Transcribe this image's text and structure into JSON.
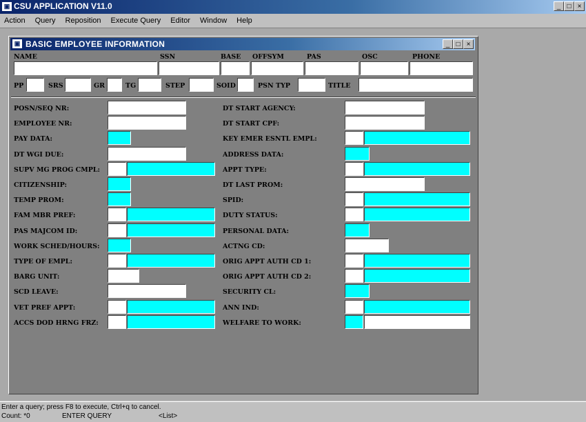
{
  "app": {
    "title": "CSU APPLICATION V11.0",
    "window_controls": [
      "_",
      "□",
      "×"
    ]
  },
  "menu": [
    "Action",
    "Query",
    "Reposition",
    "Execute Query",
    "Editor",
    "Window",
    "Help"
  ],
  "form_window": {
    "title": "BASIC EMPLOYEE INFORMATION",
    "window_controls": [
      "_",
      "□",
      "×"
    ]
  },
  "header_labels": {
    "name": "NAME",
    "ssn": "SSN",
    "base": "BASE",
    "offsym": "OFFSYM",
    "pas": "PAS",
    "osc": "OSC",
    "phone": "PHONE"
  },
  "row2_labels": {
    "pp": "PP",
    "srs": "SRS",
    "gr": "GR",
    "tg": "TG",
    "step": "STEP",
    "soid": "SOID",
    "psn_typ": "PSN TYP",
    "title": "TITLE"
  },
  "left_fields": [
    "POSN/SEQ NR:",
    "EMPLOYEE NR:",
    "PAY DATA:",
    "DT WGI DUE:",
    "SUPV MG PROG CMPL:",
    "CITIZENSHIP:",
    "TEMP PROM:",
    "FAM MBR PREF:",
    "PAS MAJCOM ID:",
    "WORK SCHED/HOURS:",
    "TYPE OF EMPL:",
    "BARG UNIT:",
    "SCD LEAVE:",
    "VET PREF APPT:",
    "ACCS DOD HRNG FRZ:"
  ],
  "right_fields": [
    "DT START AGENCY:",
    "DT START CPF:",
    "KEY EMER ESNTL EMPL:",
    "ADDRESS DATA:",
    "APPT TYPE:",
    "DT LAST PROM:",
    "SPID:",
    "DUTY STATUS:",
    "PERSONAL DATA:",
    "ACTNG CD:",
    "ORIG APPT AUTH CD 1:",
    "ORIG APPT AUTH CD 2:",
    "SECURITY CL:",
    "ANN IND:",
    "WELFARE TO WORK:"
  ],
  "status": {
    "hint": "Enter a query;  press F8 to execute, Ctrl+q  to cancel.",
    "count": "Count: *0",
    "mode": "ENTER QUERY",
    "list": "<List>"
  },
  "colors": {
    "titlebar": "#0a246a",
    "lov_field": "#00ffff",
    "form_bg": "#808080"
  }
}
